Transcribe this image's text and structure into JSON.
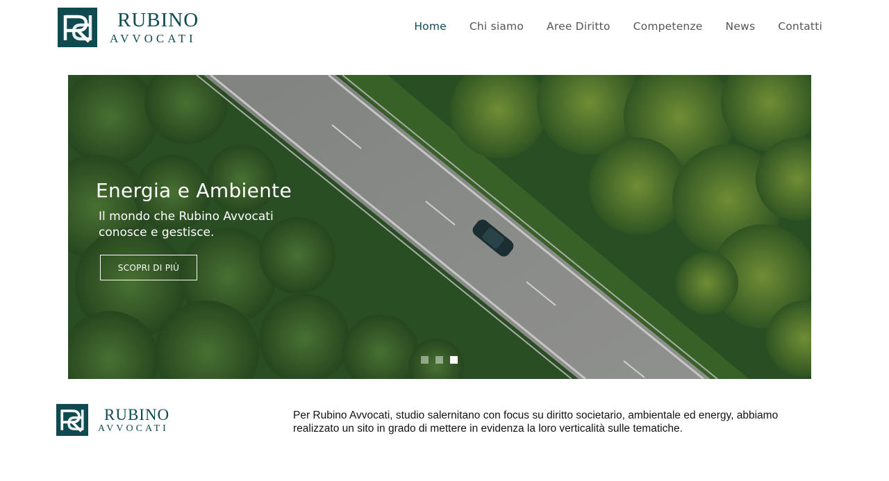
{
  "brand": {
    "name": "RUBINO",
    "subtitle": "AVVOCATI",
    "color": "#0e4a4f"
  },
  "nav": {
    "items": [
      {
        "label": "Home",
        "active": true
      },
      {
        "label": "Chi siamo",
        "active": false
      },
      {
        "label": "Aree Diritto",
        "active": false
      },
      {
        "label": "Competenze",
        "active": false
      },
      {
        "label": "News",
        "active": false
      },
      {
        "label": "Contatti",
        "active": false
      }
    ]
  },
  "hero": {
    "title": "Energia e Ambiente",
    "subtitle": "Il mondo che Rubino Avvocati conosce e gestisce.",
    "button_label": "SCOPRI DI PIÙ",
    "slides": 3,
    "active_slide": 3
  },
  "description": "Per Rubino Avvocati, studio salernitano con focus su diritto societario, ambientale ed energy, abbiamo realizzato un sito in grado di mettere in evidenza la loro verticalità sulle tematiche."
}
